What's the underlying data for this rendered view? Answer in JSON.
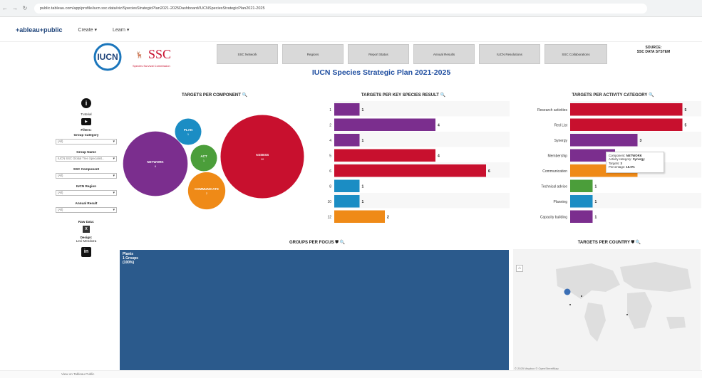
{
  "browser": {
    "url": "public.tableau.com/app/profile/iucn.ssc.data/viz/SpeciesStrategicPlan2021-2025Dashboard/IUCNSpeciesStrategicPlan2021-2025"
  },
  "app": {
    "logo": "+ableau+public",
    "menu": [
      "Create",
      "Learn"
    ]
  },
  "header": {
    "iucn": "IUCN",
    "ssc": "SSC",
    "ssc_sub": "Species Survival Commission",
    "nav": [
      "SSC Network",
      "Regions",
      "Report Status",
      "Annual Results",
      "IUCN Resolutions",
      "SSC Collaborations"
    ],
    "source_line1": "SOURCE:",
    "source_line2": "SSC DATA SYSTEM",
    "title": "IUCN Species Strategic Plan 2021-2025"
  },
  "side": {
    "tutorial": "Tutorial",
    "filters": "Filters:",
    "group_category": "Group Category",
    "group_category_val": "(All)",
    "group_name": "Group Name",
    "group_name_val": "IUCN SSC Global Tree Specialist...",
    "ssc_component": "SSC Component",
    "ssc_component_val": "(All)",
    "iucn_region": "IUCN Region",
    "iucn_region_val": "(All)",
    "annual_result": "Annual Result",
    "annual_result_val": "(All)",
    "raw_data": "Raw Data:",
    "design": "Design:",
    "designer": "Levi Mendoza"
  },
  "sections": {
    "component": "TARGETS PER COMPONENT",
    "ksr": "TARGETS PER KEY SPECIES RESULT",
    "activity": "TARGETS PER ACTIVITY CATEGORY",
    "groups": "GROUPS PER FOCUS",
    "country": "TARGETS PER COUNTRY"
  },
  "colors": {
    "assess": "#c8102e",
    "network": "#7b2e8e",
    "plan": "#1b8dc4",
    "act": "#4b9e3a",
    "communicate": "#ef8a17"
  },
  "chart_data": [
    {
      "type": "bubble",
      "title": "TARGETS PER COMPONENT",
      "categories": [
        "ASSESS",
        "NETWORK",
        "COMMUNICATE",
        "ACT",
        "PLAN"
      ],
      "values": [
        10,
        6,
        2,
        1,
        1
      ]
    },
    {
      "type": "bar",
      "title": "TARGETS PER KEY SPECIES RESULT",
      "categories": [
        "1",
        "2",
        "4",
        "5",
        "6",
        "8",
        "10",
        "12"
      ],
      "values": [
        1,
        4,
        1,
        4,
        6,
        1,
        1,
        2
      ],
      "colors": [
        "#7b2e8e",
        "#7b2e8e",
        "#7b2e8e",
        "#c8102e",
        "#c8102e",
        "#1b8dc4",
        "#1b8dc4",
        "#ef8a17"
      ]
    },
    {
      "type": "bar",
      "title": "TARGETS PER ACTIVITY CATEGORY",
      "categories": [
        "Research activities",
        "Red List",
        "Synergy",
        "Membership",
        "Communication",
        "Technical advice",
        "Planning",
        "Capacity building"
      ],
      "values": [
        5,
        5,
        3,
        2,
        3,
        1,
        1,
        1
      ],
      "colors": [
        "#c8102e",
        "#c8102e",
        "#7b2e8e",
        "#7b2e8e",
        "#ef8a17",
        "#4b9e3a",
        "#1b8dc4",
        "#7b2e8e"
      ]
    }
  ],
  "treemap": {
    "label": "Plants",
    "groups": "1 Groups",
    "pct": "(100%)"
  },
  "tooltip": {
    "component_label": "Component:",
    "component_val": "NETWORK",
    "activity_label": "Activity category:",
    "activity_val": "Synergy",
    "targets_label": "Targets:",
    "targets_val": "3",
    "pct_label": "Percentage:",
    "pct_val": "15.0%"
  },
  "map_attrib": "© 2025 Mapbox © OpenStreetMap",
  "footer": "View on Tableau Public"
}
